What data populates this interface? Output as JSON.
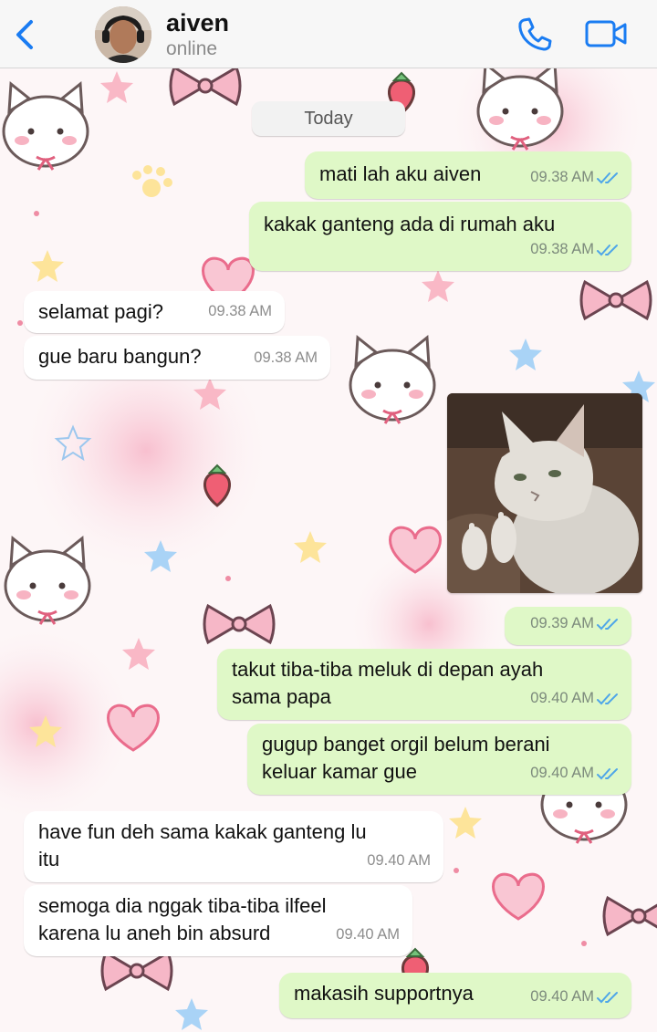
{
  "header": {
    "contact_name": "aiven",
    "status": "online",
    "icons": [
      "chevron-left-icon",
      "phone-icon",
      "video-icon"
    ],
    "accent_color": "#1a7cf2"
  },
  "chat": {
    "date_label": "Today",
    "messages": [
      {
        "direction": "outgoing",
        "text": "mati lah aku aiven",
        "time": "09.38 AM",
        "read": true
      },
      {
        "direction": "outgoing",
        "text": "kakak ganteng ada di rumah aku",
        "time": "09.38 AM",
        "read": true
      },
      {
        "direction": "incoming",
        "text": "selamat pagi?",
        "time": "09.38 AM"
      },
      {
        "direction": "incoming",
        "text": "gue baru bangun?",
        "time": "09.38 AM"
      },
      {
        "direction": "outgoing",
        "type": "photo",
        "time": "09.39 AM",
        "read": true
      },
      {
        "direction": "outgoing",
        "text_lines": [
          "takut tiba-tiba meluk di depan ayah",
          "sama papa"
        ],
        "time": "09.40 AM",
        "read": true
      },
      {
        "direction": "outgoing",
        "text_lines": [
          "gugup banget orgil belum berani",
          "keluar kamar gue"
        ],
        "time": "09.40 AM",
        "read": true
      },
      {
        "direction": "incoming",
        "text_lines": [
          "have fun deh sama kakak ganteng lu",
          "itu"
        ],
        "time": "09.40 AM"
      },
      {
        "direction": "incoming",
        "text_lines": [
          "semoga dia nggak tiba-tiba ilfeel",
          "karena lu aneh bin absurd"
        ],
        "time": "09.40 AM"
      },
      {
        "direction": "outgoing",
        "text": "makasih supportnya",
        "time": "09.40 AM",
        "read": true
      }
    ]
  },
  "colors": {
    "outgoing_bubble": "#dff8c7",
    "incoming_bubble": "#ffffff",
    "read_ticks": "#4fa6e8",
    "wallpaper": "#fdf6f7"
  }
}
